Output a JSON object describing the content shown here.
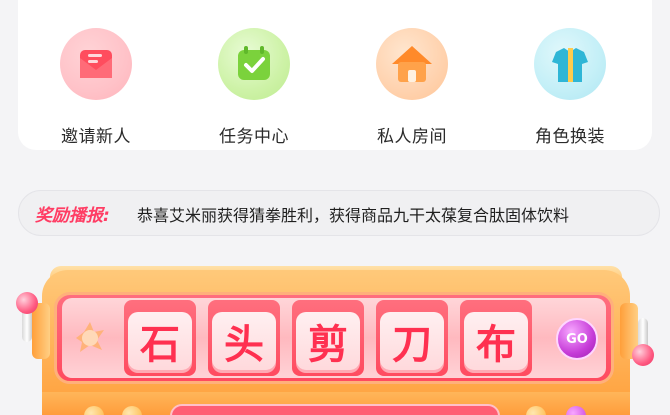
{
  "menu": {
    "items": [
      {
        "label": "邀请新人",
        "icon": "invite-envelope-icon"
      },
      {
        "label": "任务中心",
        "icon": "task-calendar-icon"
      },
      {
        "label": "私人房间",
        "icon": "house-icon"
      },
      {
        "label": "角色换装",
        "icon": "shirt-icon"
      }
    ]
  },
  "broadcast": {
    "title": "奖励播报:",
    "text": "恭喜艾米丽获得猜拳胜利，获得商品九干太葆复合肽固体饮料"
  },
  "slot_machine": {
    "reels": [
      "石",
      "头",
      "剪",
      "刀",
      "布"
    ],
    "go_label": "GO"
  },
  "colors": {
    "accent": "#ff3d64",
    "machine_orange": "#ff9f3a",
    "reel_red": "#ff4b60",
    "go_purple": "#c63cd8"
  }
}
